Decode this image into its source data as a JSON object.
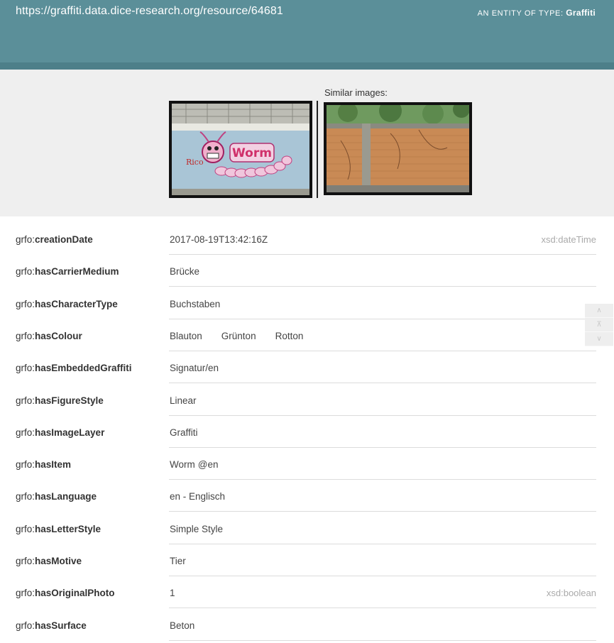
{
  "header": {
    "resource_url": "https://graffiti.data.dice-research.org/resource/64681",
    "entity_type_prefix": "An entity of type:",
    "entity_type": "Graffiti"
  },
  "gallery": {
    "similar_label": "Similar images:",
    "main_photo": {
      "caption_text": "Worm",
      "tag_text": "Rico"
    }
  },
  "properties": [
    {
      "prefix": "grfo:",
      "name": "creationDate",
      "values": [
        "2017-08-19T13:42:16Z"
      ],
      "datatype": "xsd:dateTime"
    },
    {
      "prefix": "grfo:",
      "name": "hasCarrierMedium",
      "values": [
        "Brücke"
      ]
    },
    {
      "prefix": "grfo:",
      "name": "hasCharacterType",
      "values": [
        "Buchstaben"
      ]
    },
    {
      "prefix": "grfo:",
      "name": "hasColour",
      "values": [
        "Blauton",
        "Grünton",
        "Rotton"
      ]
    },
    {
      "prefix": "grfo:",
      "name": "hasEmbeddedGraffiti",
      "values": [
        "Signatur/en"
      ]
    },
    {
      "prefix": "grfo:",
      "name": "hasFigureStyle",
      "values": [
        "Linear"
      ]
    },
    {
      "prefix": "grfo:",
      "name": "hasImageLayer",
      "values": [
        "Graffiti"
      ]
    },
    {
      "prefix": "grfo:",
      "name": "hasItem",
      "values": [
        "Worm"
      ],
      "lang": "@en"
    },
    {
      "prefix": "grfo:",
      "name": "hasLanguage",
      "values": [
        "en - Englisch"
      ]
    },
    {
      "prefix": "grfo:",
      "name": "hasLetterStyle",
      "values": [
        "Simple Style"
      ]
    },
    {
      "prefix": "grfo:",
      "name": "hasMotive",
      "values": [
        "Tier"
      ]
    },
    {
      "prefix": "grfo:",
      "name": "hasOriginalPhoto",
      "values": [
        "1"
      ],
      "datatype": "xsd:boolean"
    },
    {
      "prefix": "grfo:",
      "name": "hasSurface",
      "values": [
        "Beton"
      ]
    }
  ],
  "scroller": {
    "up_icon": "chevron-up-icon",
    "top_icon": "jump-to-top-icon",
    "down_icon": "chevron-down-icon"
  },
  "colors": {
    "header": "#5b8f99",
    "gallery_bg": "#efefef",
    "datatype": "#aaaaaa"
  }
}
